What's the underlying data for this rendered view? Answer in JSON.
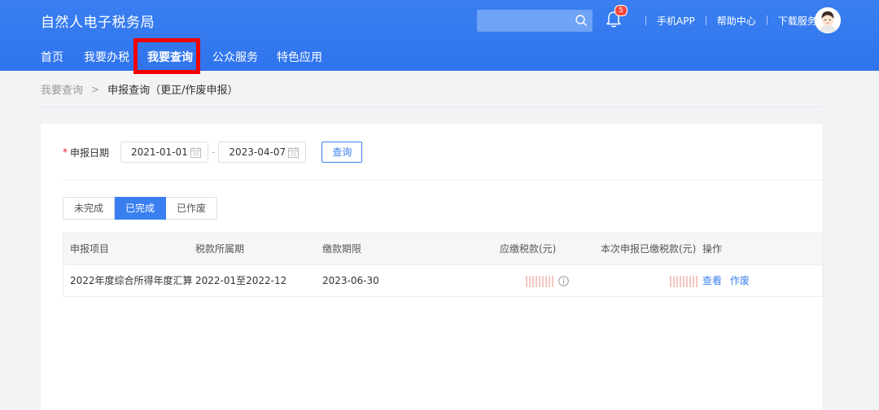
{
  "header": {
    "site_title": "自然人电子税务局",
    "search_placeholder": "",
    "notification_count": "5",
    "links": [
      "手机APP",
      "帮助中心",
      "下载服务"
    ]
  },
  "nav": {
    "items": [
      "首页",
      "我要办税",
      "我要查询",
      "公众服务",
      "特色应用"
    ],
    "active": "我要查询"
  },
  "breadcrumb": {
    "home": "我要查询",
    "separator": ">",
    "current": "申报查询（更正/作废申报）"
  },
  "form": {
    "required_mark": "*",
    "label": "申报日期",
    "start_date": "2021-01-01",
    "range_separator": "-",
    "end_date": "2023-04-07",
    "query_label": "查询"
  },
  "tabs": {
    "items": [
      "未完成",
      "已完成",
      "已作废"
    ],
    "active": "已完成"
  },
  "table": {
    "headers": [
      "申报项目",
      "税款所属期",
      "缴款期限",
      "应缴税款(元)",
      "本次申报已缴税款(元)",
      "操作"
    ],
    "rows": [
      {
        "item": "2022年度综合所得年度汇算",
        "period": "2022-01至2022-12",
        "deadline": "2023-06-30",
        "actions": [
          "查看",
          "作废"
        ]
      }
    ]
  },
  "colors": {
    "brand_blue": "#3a7ff0",
    "highlight_red": "#f00000",
    "badge_red": "#f5483b"
  }
}
